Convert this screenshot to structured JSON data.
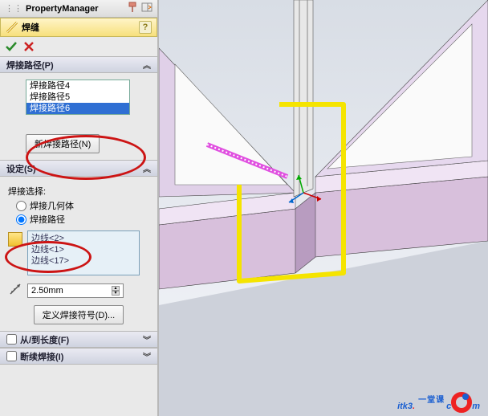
{
  "title": "PropertyManager",
  "feature_name": "焊缝",
  "sections": {
    "weld_path": {
      "title": "焊接路径(P)",
      "items": [
        "焊接路径4",
        "焊接路径5",
        "焊接路径6"
      ],
      "new_btn": "新焊接路径(N)"
    },
    "settings": {
      "title": "设定(S)",
      "select_label": "焊接选择:",
      "radio_geom": "焊接几何体",
      "radio_path": "焊接路径",
      "edges": [
        "边线<2>",
        "边线<1>",
        "边线<17>"
      ],
      "size_value": "2.50mm",
      "define_symbol": "定义焊接符号(D)..."
    },
    "from_to": {
      "title": "从/到长度(F)"
    },
    "intermittent": {
      "title": "断续焊接(I)"
    }
  },
  "watermark": {
    "brand_a": "itk3",
    "brand_b": "c",
    "brand_c": "m",
    "tag": "一堂课"
  }
}
